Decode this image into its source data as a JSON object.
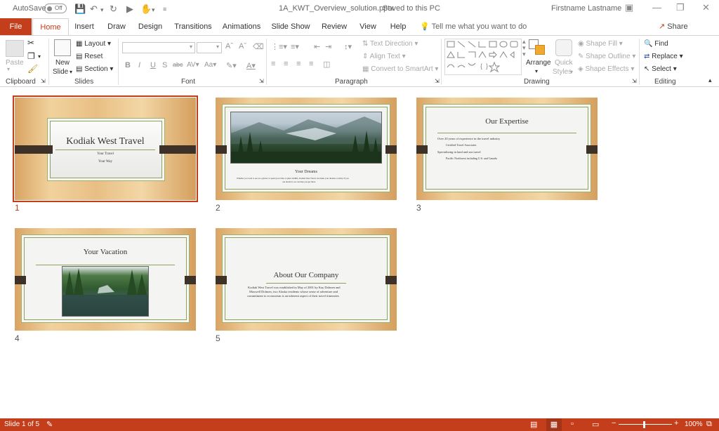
{
  "titlebar": {
    "autosave_label": "AutoSave",
    "autosave_state": "Off",
    "doc_title": "1A_KWT_Overview_solution.pptx",
    "save_status": "Saved to this PC",
    "user_name": "Firstname Lastname"
  },
  "tabs": [
    "File",
    "Home",
    "Insert",
    "Draw",
    "Design",
    "Transitions",
    "Animations",
    "Slide Show",
    "Review",
    "View",
    "Help"
  ],
  "active_tab": "Home",
  "tell_me": "Tell me what you want to do",
  "share_label": "Share",
  "ribbon": {
    "clipboard": {
      "label": "Clipboard",
      "paste": "Paste"
    },
    "slides": {
      "label": "Slides",
      "new_slide_1": "New",
      "new_slide_2": "Slide",
      "layout": "Layout",
      "reset": "Reset",
      "section": "Section"
    },
    "font": {
      "label": "Font"
    },
    "paragraph": {
      "label": "Paragraph",
      "text_direction": "Text Direction",
      "align_text": "Align Text",
      "convert_smartart": "Convert to SmartArt"
    },
    "drawing": {
      "label": "Drawing",
      "arrange": "Arrange",
      "quick_styles_1": "Quick",
      "quick_styles_2": "Styles",
      "shape_fill": "Shape Fill",
      "shape_outline": "Shape Outline",
      "shape_effects": "Shape Effects"
    },
    "editing": {
      "label": "Editing",
      "find": "Find",
      "replace": "Replace",
      "select": "Select"
    }
  },
  "slides": [
    {
      "num": "1",
      "title": "Kodiak West Travel",
      "sub1": "Your Travel",
      "sub2": "Your Way"
    },
    {
      "num": "2",
      "caption": "Your Dreams",
      "body1": "Whether you want to see an a glacier or spend your time at quiet wildlife, Kodiak West Travel can make your dreams a reality. If you",
      "body2": "can dream it, we can help you get there."
    },
    {
      "num": "3",
      "title": "Our Expertise",
      "b1": "Over 20 years of experience in the travel industry",
      "b1a": "Certified Travel Associates",
      "b2": "Specializing in land and sea travel",
      "b2a": "Pacific Northwest including U.S. and Canada"
    },
    {
      "num": "4",
      "title": "Your Vacation"
    },
    {
      "num": "5",
      "title": "About Our Company",
      "body1": "Kodiak West Travel was established in May of 2001 by Kay Dolmen and",
      "body2": "Maxwell Dolmen, two Alaska residents whose sense of adventure and",
      "body3": "commitment to ecotourism is an inherent aspect of their travel itineraries"
    }
  ],
  "status": {
    "slide_info": "Slide 1 of 5",
    "zoom": "100%"
  }
}
